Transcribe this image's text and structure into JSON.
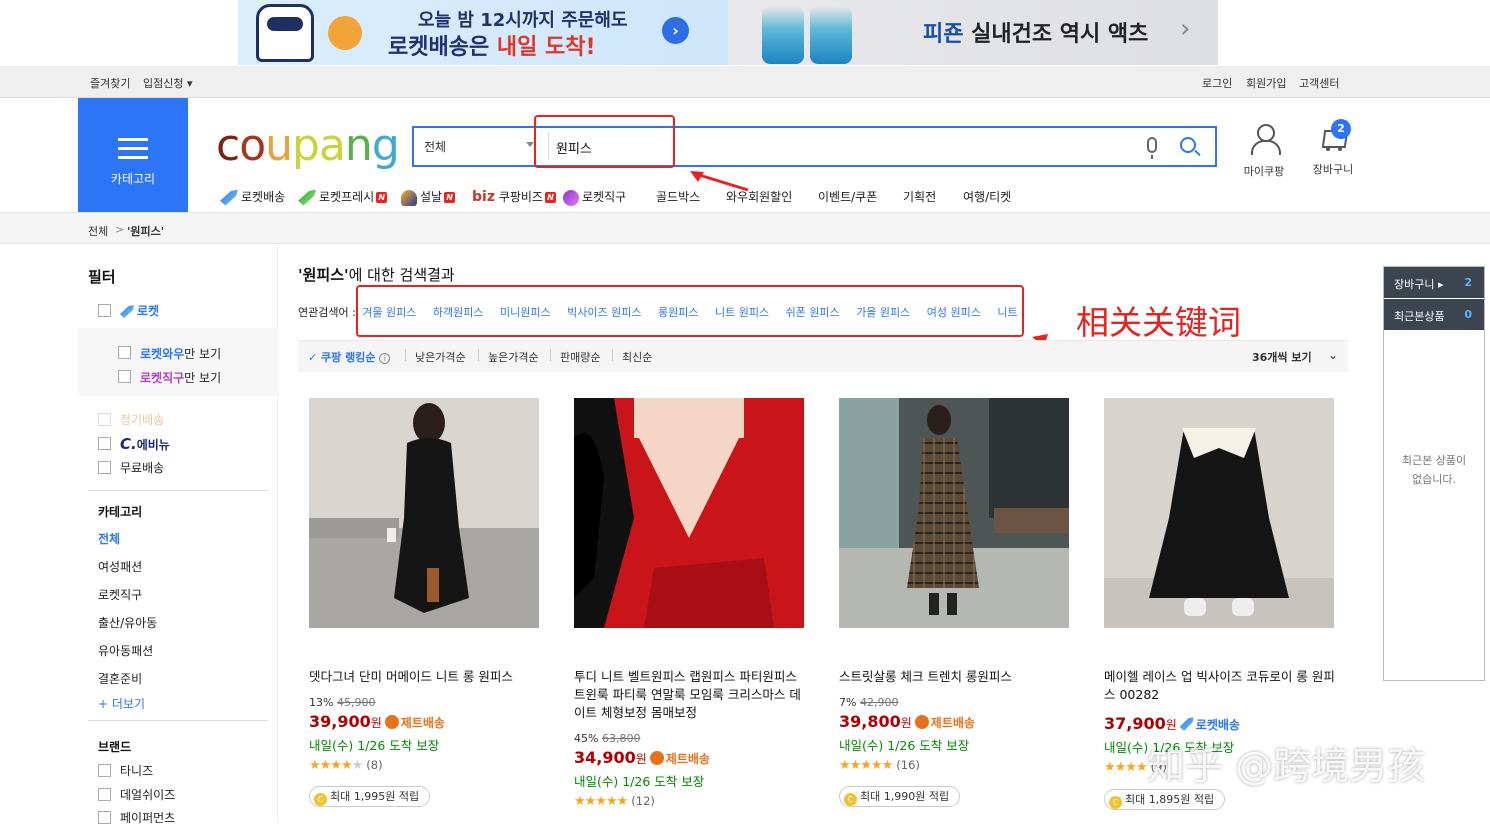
{
  "banner": {
    "left_line1": "오늘 밤 12시까지 주문해도",
    "left_line2_a": "로켓배송은 ",
    "left_line2_b": "내일 도착!",
    "right_brand": "피죤",
    "right_text": " 실내건조 역시 액츠",
    "bg_left": "#d6ebfb",
    "bg_right": "#e4e5e8"
  },
  "util": {
    "favorites": "즐겨찾기",
    "apply": "입점신청 ▾",
    "login": "로그인",
    "signup": "회원가입",
    "cs": "고객센터"
  },
  "header": {
    "category_label": "카테고리",
    "logo": [
      "c",
      "o",
      "u",
      "p",
      "a",
      "n",
      "g"
    ],
    "search_scope": "전체",
    "search_value": "원피스",
    "mypage": "마이쿠팡",
    "cart": "장바구니",
    "cart_count": "2",
    "accent": "#2c75f6"
  },
  "nav": [
    {
      "label": "로켓배송",
      "icon": "rocket-icon",
      "badge": ""
    },
    {
      "label": "로켓프레시",
      "icon": "rocket-fresh-icon",
      "badge": "N"
    },
    {
      "label": "설날",
      "icon": "new-year-icon",
      "badge": "N"
    },
    {
      "label": "쿠팡비즈",
      "prefix": "biz",
      "badge": "N"
    },
    {
      "label": "로켓직구",
      "icon": "global-icon",
      "badge": ""
    },
    {
      "label": "골드박스"
    },
    {
      "label": "와우회원할인"
    },
    {
      "label": "이벤트/쿠폰"
    },
    {
      "label": "기획전"
    },
    {
      "label": "여행/티켓"
    }
  ],
  "breadcrumb": {
    "root": "전체",
    "sep": ">",
    "current": "'원피스'"
  },
  "filter": {
    "title": "필터",
    "rocket": "로켓",
    "wow_a": "로켓와우",
    "wow_b": "만 보기",
    "jikgu_a": "로켓직구",
    "jikgu_b": "만 보기",
    "regular": "정기배송",
    "everyday": "에비뉴",
    "everyday_prefix": "C.",
    "free": "무료배송",
    "category_title": "카테고리",
    "categories": [
      "전체",
      "여성패션",
      "로켓직구",
      "출산/유아동",
      "유아동패션",
      "결혼준비"
    ],
    "more": "+ 더보기",
    "brand_title": "브랜드",
    "brands": [
      "타니즈",
      "데얼쉬이즈",
      "페이퍼먼츠"
    ]
  },
  "results": {
    "title_q": "'원피스'",
    "title_rest": "에 대한 검색결과",
    "related_label": "연관검색어 :",
    "related": [
      "겨울 원피스",
      "하객원피스",
      "미니원피스",
      "빅사이즈 원피스",
      "롱원피스",
      "니트 원피스",
      "쉬폰 원피스",
      "가을 원피스",
      "여성 원피스",
      "니트"
    ],
    "annotation": "相关关键词",
    "sort": [
      "쿠팡 랭킹순",
      "낮은가격순",
      "높은가격순",
      "판매량순",
      "최신순"
    ],
    "per_page": "36개씩 보기"
  },
  "products": [
    {
      "title": "뎃다그녀 단미 머메이드 니트 롱 원피스",
      "discount": "13%",
      "orig": "45,900",
      "price": "39,900",
      "won": "원",
      "delivery": "제트배송",
      "arrival": "내일(수) 1/26 도착 보장",
      "stars": "★★★★",
      "stars_off": "★",
      "reviews": "(8)",
      "cash": "최대 1,995원 적립"
    },
    {
      "title": "투디 니트 벨트원피스 랩원피스 파티원피스 트윈룩 파티룩 연말룩 모임룩 크리스마스 데이트 체형보정 몸매보정",
      "discount": "45%",
      "orig": "63,800",
      "price": "34,900",
      "won": "원",
      "delivery": "제트배송",
      "arrival": "내일(수) 1/26 도착 보장",
      "stars": "★★★★★",
      "stars_off": "",
      "reviews": "(12)",
      "cash": ""
    },
    {
      "title": "스트릿살롱 체크 트렌치 롱원피스",
      "discount": "7%",
      "orig": "42,900",
      "price": "39,800",
      "won": "원",
      "delivery": "제트배송",
      "arrival": "내일(수) 1/26 도착 보장",
      "stars": "★★★★★",
      "stars_off": "",
      "reviews": "(16)",
      "cash": "최대 1,990원 적립"
    },
    {
      "title": "메이헬 레이스 업 빅사이즈 코듀로이 롱 원피스 00282",
      "discount": "",
      "orig": "",
      "price": "37,900",
      "won": "원",
      "delivery": "로켓배송",
      "arrival": "내일(수) 1/26 도착 보장",
      "stars": "★★★★",
      "stars_off": "",
      "reviews": "(9)",
      "cash": "최대 1,895원 적립"
    }
  ],
  "side": {
    "cart": "장바구니 ▸",
    "cart_count": "2",
    "recent": "최근본상품",
    "recent_count": "0",
    "empty_line1": "최근본 상품이",
    "empty_line2": "없습니다."
  },
  "watermark": "知乎 @跨境男孩"
}
